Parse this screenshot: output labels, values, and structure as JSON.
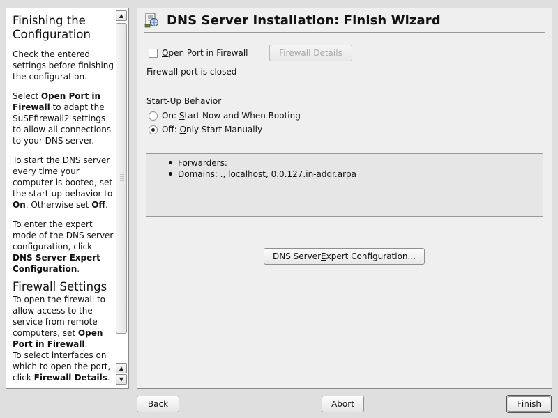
{
  "help": {
    "heading": "Finishing the Configuration",
    "p1": "Check the entered settings before finishing the configuration.",
    "p2": {
      "a": "Select ",
      "b": "Open Port in Firewall",
      "c": " to adapt the SuSEfirewall2 settings to allow all connections to your DNS server."
    },
    "p3": {
      "a": "To start the DNS server every time your computer is booted, set the start-up behavior to ",
      "b": "On",
      "c": ". Otherwise set ",
      "d": "Off",
      "e": "."
    },
    "p4": {
      "a": "To enter the expert mode of the DNS server configuration, click ",
      "b": "DNS Server Expert Configuration",
      "c": "."
    },
    "heading2": "Firewall Settings",
    "p5": {
      "a": "To open the firewall to allow access to the service from remote computers, set ",
      "b": "Open Port in Firewall",
      "c": "."
    },
    "p6": {
      "a": "To select interfaces on which to open the port, click ",
      "b": "Firewall Details",
      "c": "."
    }
  },
  "main": {
    "title": "DNS Server Installation: Finish Wizard",
    "open_port": {
      "mnemonic": "O",
      "rest": "pen Port in Firewall",
      "checked": false
    },
    "firewall_details_label": "Firewall Details",
    "firewall_status": "Firewall port is closed",
    "startup_label": "Start-Up Behavior",
    "radio_on": {
      "prefix": "On: ",
      "mnemonic": "S",
      "rest": "tart Now and When Booting",
      "checked": false
    },
    "radio_off": {
      "prefix": "Off: ",
      "mnemonic": "O",
      "rest": "nly Start Manually",
      "checked": true
    },
    "summary": [
      "Forwarders:",
      "Domains: ., localhost, 0.0.127.in-addr.arpa"
    ],
    "expert_button": {
      "a": "DNS Server ",
      "mnemonic": "E",
      "b": "xpert Configuration..."
    }
  },
  "footer": {
    "back": {
      "mnemonic": "B",
      "rest": "ack"
    },
    "abort": {
      "a": "Abo",
      "mnemonic": "r",
      "b": "t"
    },
    "finish": {
      "mnemonic": "F",
      "rest": "inish"
    }
  },
  "icons": {
    "app": "yast-dns-server-icon",
    "scroll_up": "arrow-up-icon",
    "scroll_down": "arrow-down-icon"
  }
}
